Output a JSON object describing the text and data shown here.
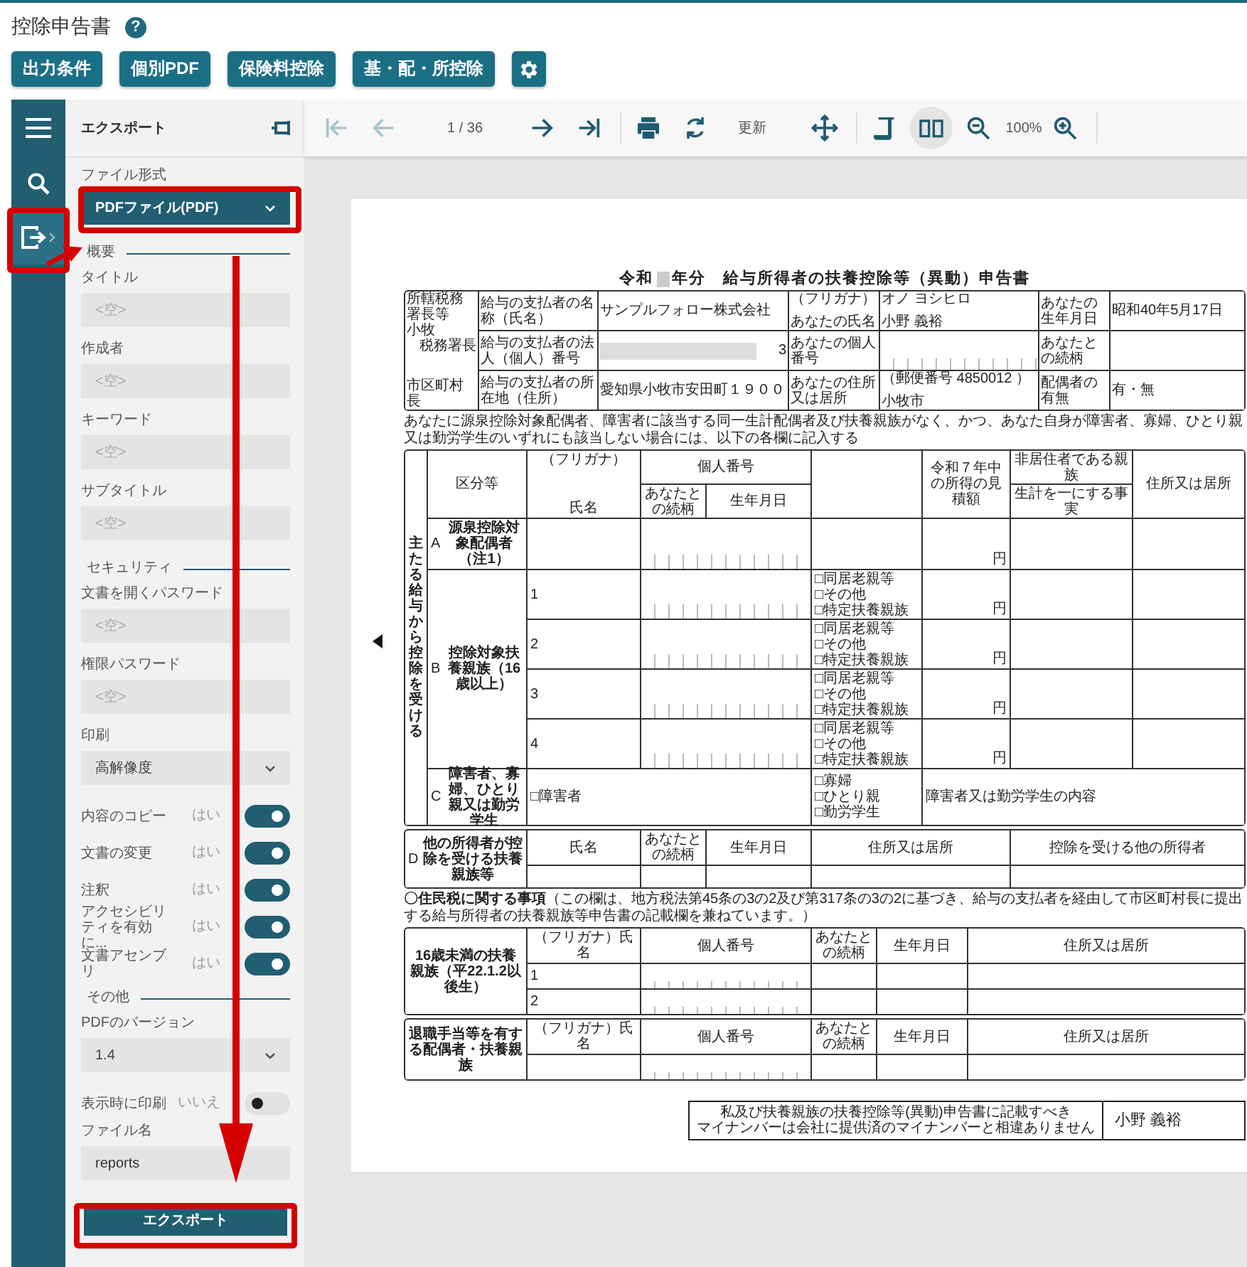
{
  "app": {
    "title": "控除申告書",
    "help": "?",
    "buttons": [
      "出力条件",
      "個別PDF",
      "保険料控除",
      "基・配・所控除"
    ]
  },
  "rail": [
    {
      "kind": "menu",
      "selected": false
    },
    {
      "kind": "search",
      "selected": false
    },
    {
      "kind": "export",
      "selected": true
    }
  ],
  "panel": {
    "title": "エクスポート",
    "fields": [
      {
        "kind": "select",
        "label": "ファイル形式",
        "value": "PDFファイル(PDF)",
        "focused": true
      },
      {
        "kind": "heading",
        "label": "概要"
      },
      {
        "kind": "text",
        "label": "タイトル",
        "placeholder": "<空>"
      },
      {
        "kind": "text",
        "label": "作成者",
        "placeholder": "<空>"
      },
      {
        "kind": "text",
        "label": "キーワード",
        "placeholder": "<空>"
      },
      {
        "kind": "text",
        "label": "サブタイトル",
        "placeholder": "<空>"
      },
      {
        "kind": "heading",
        "label": "セキュリティ"
      },
      {
        "kind": "text",
        "label": "文書を開くパスワード",
        "placeholder": "<空>"
      },
      {
        "kind": "text",
        "label": "権限パスワード",
        "placeholder": "<空>"
      },
      {
        "kind": "select",
        "label": "印刷",
        "value": "高解像度",
        "focused": false
      },
      {
        "kind": "toggle",
        "label": "内容のコピー",
        "state_label": "はい",
        "on": true
      },
      {
        "kind": "toggle",
        "label": "文書の変更",
        "state_label": "はい",
        "on": true
      },
      {
        "kind": "toggle",
        "label": "注釈",
        "state_label": "はい",
        "on": true
      },
      {
        "kind": "toggle",
        "label": "アクセシビリティを有効に...",
        "state_label": "はい",
        "on": true
      },
      {
        "kind": "toggle",
        "label": "文書アセンブリ",
        "state_label": "はい",
        "on": true
      },
      {
        "kind": "heading",
        "label": "その他"
      },
      {
        "kind": "select",
        "label": "PDFのバージョン",
        "value": "1.4",
        "focused": false
      },
      {
        "kind": "toggle",
        "label": "表示時に印刷",
        "state_label": "いいえ",
        "on": false
      },
      {
        "kind": "text",
        "label": "ファイル名",
        "value": "reports"
      }
    ],
    "export_button": "エクスポート"
  },
  "toolbar": [
    {
      "kind": "first",
      "disabled": true
    },
    {
      "kind": "prev",
      "disabled": true
    },
    {
      "kind": "page",
      "text": "1 / 36"
    },
    {
      "kind": "next",
      "disabled": false
    },
    {
      "kind": "last",
      "disabled": false
    },
    {
      "kind": "separator"
    },
    {
      "kind": "print",
      "disabled": false
    },
    {
      "kind": "refresh",
      "disabled": false
    },
    {
      "kind": "label",
      "text": "更新"
    },
    {
      "kind": "move",
      "disabled": false
    },
    {
      "kind": "separator"
    },
    {
      "kind": "continuous",
      "disabled": false,
      "selected": false
    },
    {
      "kind": "single",
      "disabled": false,
      "selected": true
    },
    {
      "kind": "zoom-out",
      "disabled": false
    },
    {
      "kind": "zoom",
      "text": "100%"
    },
    {
      "kind": "zoom-in",
      "disabled": false
    },
    {
      "kind": "separator"
    }
  ],
  "document": {
    "title_prefix": "令和",
    "title": "年分　給与所得者の扶養控除等（異動）申告書",
    "header": {
      "office_label": "所轄税務署長等",
      "office": "小牧",
      "office_suffix": "税務署長",
      "city_label": "市区町村長",
      "payer": [
        {
          "label": "給与の支払者の名称（氏名）",
          "value": "サンプルフォロー株式会社"
        },
        {
          "label": "給与の支払者の法人（個人）番号",
          "value": "3"
        },
        {
          "label": "給与の支払者の所在地（住所）",
          "value": "愛知県小牧市安田町１９００"
        }
      ],
      "furigana_label": "（フリガナ）",
      "furigana": "オノ ヨシヒロ",
      "name_label": "あなたの氏名",
      "name": "小野 義裕",
      "number_label": "あなたの個人番号",
      "address_label": "あなたの住所又は居所",
      "postal": "（郵便番号 4850012 ）",
      "address": "小牧市",
      "side": [
        {
          "label": "あなたの生年月日",
          "value": "昭和40年5月17日"
        },
        {
          "label": "あなたとの続柄"
        },
        {
          "label": "配偶者の有無",
          "value": "有・無"
        }
      ]
    },
    "notice": "あなたに源泉控除対象配偶者、障害者に該当する同一生計配偶者及び扶養親族がなく、かつ、あなた自身が障害者、寡婦、ひとり親又は勤労学生のいずれにも該当しない場合には、以下の各欄に記入する",
    "main": {
      "side_label": "主たる給与から控除を受ける",
      "headers": {
        "category": "区分等",
        "furigana": "（フリガナ）",
        "name": "氏名",
        "number": "個人番号",
        "relation": "あなたとの続柄",
        "birth": "生年月日",
        "income": "令和７年中の所得の見積額",
        "nonresident": "非居住者である親族",
        "livelihood": "生計を一にする事実",
        "address": "住所又は居所"
      },
      "spouse": {
        "code": "A",
        "label": "源泉控除対象配偶者（注1）",
        "yen": "円"
      },
      "dependents": {
        "code": "B",
        "label": "控除対象扶養親族（16歳以上）",
        "rows": [
          {
            "no": "1",
            "options": [
              "□同居老親等",
              "□その他",
              "□特定扶養親族"
            ],
            "yen": "円"
          },
          {
            "no": "2",
            "options": [
              "□同居老親等",
              "□その他",
              "□特定扶養親族"
            ],
            "yen": "円"
          },
          {
            "no": "3",
            "options": [
              "□同居老親等",
              "□その他",
              "□特定扶養親族"
            ],
            "yen": "円"
          },
          {
            "no": "4",
            "options": [
              "□同居老親等",
              "□その他",
              "□特定扶養親族"
            ],
            "yen": "円"
          }
        ]
      },
      "disability": {
        "code": "C",
        "label": "障害者、寡婦、ひとり親又は勤労学生",
        "person": "□障害者",
        "options": [
          "□寡婦",
          "□ひとり親",
          "□勤労学生"
        ],
        "detail": "障害者又は勤労学生の内容"
      }
    },
    "others": {
      "code": "D",
      "label": "他の所得者が控除を受ける扶養親族等",
      "headers": [
        "氏名",
        "あなたとの続柄",
        "生年月日",
        "住所又は居所",
        "控除を受ける他の所得者"
      ]
    },
    "resident_note": "**〇住民税に関する事項**（この欄は、地方税法第45条の3の2及び第317条の3の2に基づき、給与の支払者を経由して市区町村長に提出する給与所得者の扶養親族等申告書の記載欄を兼ねています。）",
    "under16": {
      "label": "16歳未満の扶養親族（平22.1.2以後生）",
      "headers": [
        "（フリガナ）氏名",
        "個人番号",
        "あなたとの続柄",
        "生年月日",
        "住所又は居所"
      ],
      "rows": [
        "1",
        "2"
      ]
    },
    "retirement": {
      "label": "退職手当等を有する配偶者・扶養親族",
      "headers": [
        "（フリガナ）氏名",
        "個人番号",
        "あなたとの続柄",
        "生年月日",
        "住所又は居所"
      ]
    },
    "confirmation": {
      "lines": [
        "私及び扶養親族の扶養控除等(異動)申告書に記載すべき",
        "マイナンバーは会社に提供済のマイナンバーと相違ありません"
      ],
      "name": "小野 義裕"
    }
  }
}
